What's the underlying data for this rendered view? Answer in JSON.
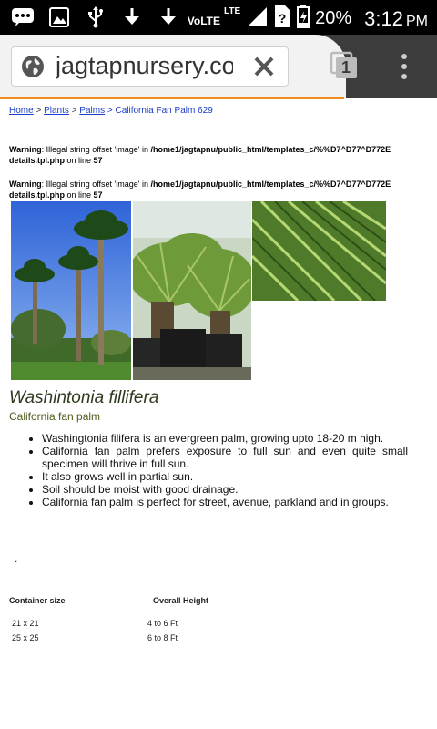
{
  "status_bar": {
    "network_label": "VoLTE",
    "lte_label": "LTE",
    "battery_percent": "20%",
    "time": "3:12",
    "ampm": "PM",
    "icons": [
      "message-icon",
      "image-icon",
      "usb-icon",
      "download-icon",
      "download-icon",
      "signal-icon",
      "no-sim-icon",
      "battery-icon"
    ]
  },
  "browser": {
    "url": "jagtapnursery.com",
    "tab_count": "1",
    "accent_color": "#f08c1e"
  },
  "breadcrumb": {
    "home": "Home",
    "sep1": " > ",
    "plants": "Plants",
    "sep2": " > ",
    "palms": "Palms",
    "current": " > California Fan Palm 629"
  },
  "warnings": [
    {
      "label": "Warning",
      "message": ": Illegal string offset 'image' in ",
      "path": "/home1/jagtapnu/public_html/templates_c/%%D7^D77^D772E",
      "file": "details.tpl.php",
      "line_text": " on line ",
      "line": "57"
    },
    {
      "label": "Warning",
      "message": ": Illegal string offset 'image' in ",
      "path": "/home1/jagtapnu/public_html/templates_c/%%D7^D77^D772E",
      "file": "details.tpl.php",
      "line_text": " on line ",
      "line": "57"
    }
  ],
  "product": {
    "title": "Washintonia fillifera",
    "subtitle": "California fan palm",
    "bullets": [
      "Washingtonia filifera is an evergreen palm, growing upto 18-20 m high.",
      "California fan palm prefers exposure to full sun and even quite small specimen will thrive in full sun.",
      "It also grows well in partial sun.",
      "Soil should be moist with good drainage.",
      "California fan palm is perfect for street, avenue, parkland and in groups."
    ],
    "dot": "."
  },
  "table": {
    "headers": [
      "Container size",
      "Overall Height"
    ],
    "rows": [
      [
        "21 x 21",
        "4 to 6 Ft"
      ],
      [
        "25 x 25",
        "6 to 8 Ft"
      ]
    ]
  }
}
